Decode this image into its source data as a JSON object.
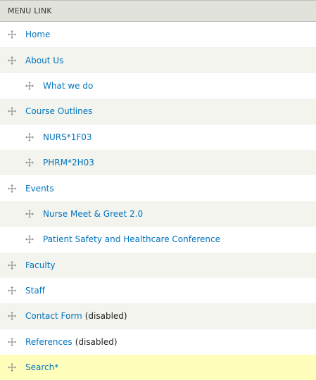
{
  "table": {
    "header": "MENU LINK",
    "rows": [
      {
        "label": "Home",
        "suffix": "",
        "level": 0
      },
      {
        "label": "About Us",
        "suffix": "",
        "level": 0
      },
      {
        "label": "What we do",
        "suffix": "",
        "level": 1
      },
      {
        "label": "Course Outlines",
        "suffix": "",
        "level": 0
      },
      {
        "label": "NURS*1F03",
        "suffix": "",
        "level": 1
      },
      {
        "label": "PHRM*2H03",
        "suffix": "",
        "level": 1
      },
      {
        "label": "Events",
        "suffix": "",
        "level": 0
      },
      {
        "label": "Nurse Meet & Greet 2.0",
        "suffix": "",
        "level": 1
      },
      {
        "label": "Patient Safety and Healthcare Conference",
        "suffix": "",
        "level": 1
      },
      {
        "label": "Faculty",
        "suffix": "",
        "level": 0
      },
      {
        "label": "Staff",
        "suffix": "",
        "level": 0
      },
      {
        "label": "Contact Form",
        "suffix": "(disabled)",
        "level": 0
      },
      {
        "label": "References",
        "suffix": "(disabled)",
        "level": 0
      },
      {
        "label": "Search*",
        "suffix": "",
        "level": 0,
        "highlighted": true
      }
    ]
  },
  "icons": {
    "drag": "drag-handle-icon"
  },
  "colors": {
    "link": "#0074bd",
    "header_bg": "#e1e2dc",
    "row_alt_bg": "#f3f4ee",
    "highlight_bg": "#ffffbb"
  }
}
